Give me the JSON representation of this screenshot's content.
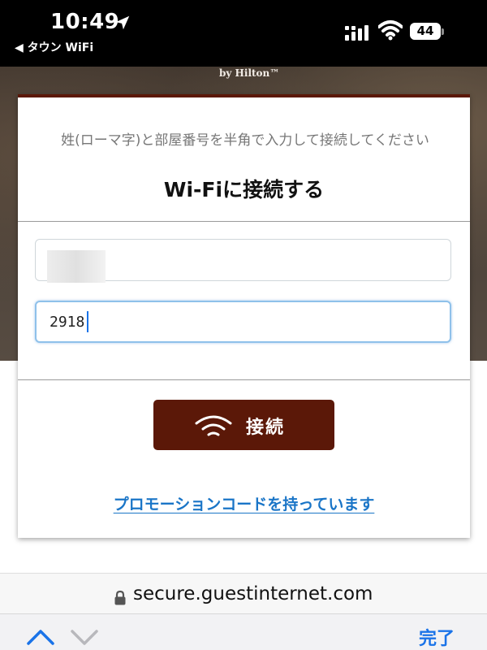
{
  "status_bar": {
    "time": "10:49",
    "back_app": "◀ タウン WiFi",
    "battery_level": "44",
    "icons": [
      "location-arrow-icon",
      "cellular-signal-icon",
      "wifi-icon",
      "battery-icon"
    ]
  },
  "hotel": {
    "brand": "by Hilton™"
  },
  "form": {
    "instruction": "姓(ローマ字)と部屋番号を半角で入力して接続してください",
    "title": "Wi-Fiに接続する",
    "last_name_value": "",
    "room_number_value": "2918",
    "connect_label": "接続",
    "promo_link": "プロモーションコードを持っています"
  },
  "browser": {
    "url": "secure.guestinternet.com"
  },
  "keyboard_bar": {
    "done_label": "完了"
  },
  "colors": {
    "brand_maroon": "#5b1808",
    "link_blue": "#1a75c7",
    "ios_blue": "#1a73e8"
  }
}
